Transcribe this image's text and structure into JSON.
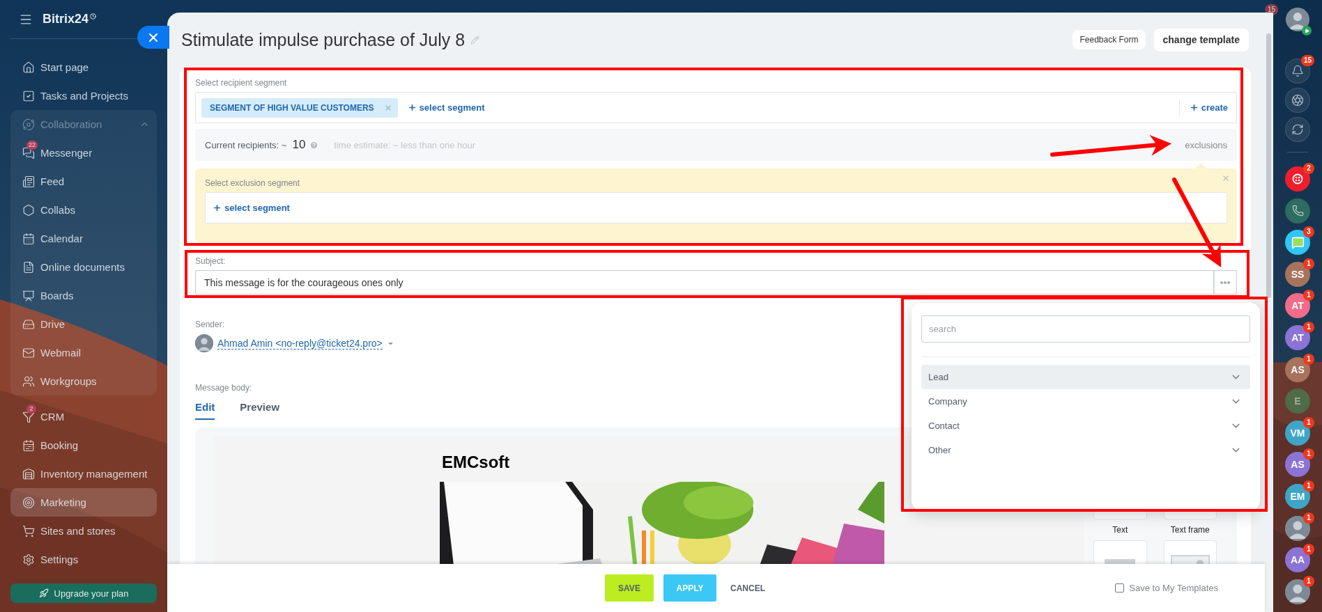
{
  "sidebar": {
    "title": "Bitrix24",
    "items": [
      {
        "label": "Start page",
        "selected": false
      },
      {
        "label": "Tasks and Projects",
        "selected": false
      },
      {
        "label": "Collaboration",
        "selected": false,
        "expanded": true,
        "children": [
          {
            "label": "Messenger",
            "badge": "22",
            "selected": false
          },
          {
            "label": "Feed",
            "selected": false
          },
          {
            "label": "Collabs",
            "selected": false
          },
          {
            "label": "Calendar",
            "selected": false
          },
          {
            "label": "Online documents",
            "selected": false
          },
          {
            "label": "Boards",
            "selected": false
          },
          {
            "label": "Drive",
            "selected": false
          },
          {
            "label": "Webmail",
            "selected": false
          },
          {
            "label": "Workgroups",
            "selected": false
          }
        ]
      },
      {
        "label": "CRM",
        "badge": "2",
        "selected": false
      },
      {
        "label": "Booking",
        "selected": false
      },
      {
        "label": "Inventory management",
        "selected": false
      },
      {
        "label": "Marketing",
        "selected": true
      },
      {
        "label": "Sites and stores",
        "selected": false
      },
      {
        "label": "Settings",
        "selected": false
      }
    ],
    "upgrade_button": "Upgrade your plan"
  },
  "slider": {
    "title": "Stimulate impulse purchase of July 8",
    "header_buttons": [
      "Feedback Form",
      "change template"
    ],
    "recipient_segment": {
      "label": "Select recipient segment",
      "tags": [
        "SEGMENT OF HIGH VALUE CUSTOMERS"
      ],
      "add_link": "select segment",
      "create_link": "create"
    },
    "recipients": {
      "label": "Current recipients: ~",
      "count": "10",
      "estimate": "time estimate: ~ less than one hour",
      "exclusions_link": "exclusions"
    },
    "exclusion_segment": {
      "label": "Select exclusion segment",
      "add_link": "select segment"
    },
    "subject": {
      "label": "Subject:",
      "value": "This message is for the courageous ones only"
    },
    "sender": {
      "label": "Sender:",
      "value": "Ahmad Amin <no-reply@ticket24.pro>"
    },
    "message_body": {
      "label": "Message body:",
      "tabs": [
        {
          "label": "Edit",
          "selected": true
        },
        {
          "label": "Preview",
          "selected": false
        }
      ]
    },
    "editor": {
      "heading": "EMCsoft",
      "blocks": [
        "Text",
        "Text frame"
      ]
    },
    "footer": {
      "buttons": [
        {
          "label": "SAVE",
          "kind": "save"
        },
        {
          "label": "APPLY",
          "kind": "apply"
        },
        {
          "label": "CANCEL",
          "kind": "cancel"
        }
      ],
      "save_template": {
        "label": "Save to My Templates",
        "checked": false
      }
    }
  },
  "field_menu": {
    "placeholder": "search",
    "items": [
      {
        "label": "Lead",
        "selected": true
      },
      {
        "label": "Company",
        "selected": false
      },
      {
        "label": "Contact",
        "selected": false
      },
      {
        "label": "Other",
        "selected": false
      }
    ]
  },
  "right_rail": {
    "counter": "15",
    "tools": [
      {
        "kind": "notifications",
        "badge": "15"
      },
      {
        "kind": "activity"
      },
      {
        "kind": "messages"
      }
    ],
    "chats": [
      {
        "kind": "connector",
        "color": "#f01e2c",
        "badge": "2"
      },
      {
        "kind": "phone",
        "color": "#2e6b61"
      },
      {
        "kind": "chat",
        "color": "#2fc6f6",
        "badge": "3"
      },
      {
        "kind": "initials",
        "initials": "SS",
        "color": "#a8735c",
        "badge": "1"
      },
      {
        "kind": "initials",
        "initials": "AT",
        "color": "#f16b8a",
        "badge": "1"
      },
      {
        "kind": "initials",
        "initials": "AT",
        "color": "#8c73d6",
        "badge": "1"
      },
      {
        "kind": "initials",
        "initials": "AS",
        "color": "#a8735c",
        "badge": "1"
      },
      {
        "kind": "initials",
        "initials": "E",
        "color": "#4f6b47"
      },
      {
        "kind": "initials",
        "initials": "VM",
        "color": "#3ea5c7",
        "badge": "1"
      },
      {
        "kind": "initials",
        "initials": "AS",
        "color": "#8c73d6",
        "badge": "1"
      },
      {
        "kind": "initials",
        "initials": "EM",
        "color": "#3ea5c7",
        "badge": "1"
      },
      {
        "badge": "1"
      },
      {
        "kind": "initials",
        "initials": "AA",
        "color": "#8c73d6",
        "badge": "1"
      },
      {
        "badge": "1"
      }
    ]
  }
}
